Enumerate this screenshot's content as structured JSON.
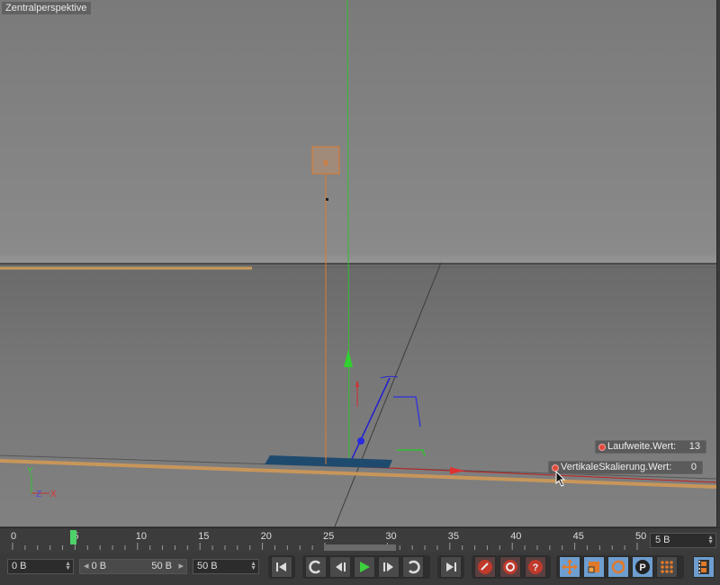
{
  "viewport": {
    "title": "Zentralperspektive"
  },
  "scene": {
    "object_marker_label": "s",
    "axis_labels": {
      "y": "Y",
      "z": "Z",
      "x": "X"
    }
  },
  "hud": [
    {
      "label": "Laufweite.Wert:",
      "value": "13"
    },
    {
      "label": "VertikaleSkalierung.Wert:",
      "value": "0"
    }
  ],
  "timeline": {
    "ruler_labels": [
      "0",
      "5",
      "10",
      "15",
      "20",
      "25",
      "30",
      "35",
      "40",
      "45",
      "50"
    ],
    "current_frame": 5,
    "frame_display": "5 B"
  },
  "toolbar": {
    "start_field": "0 B",
    "range_start": "0 B",
    "range_end": "50 B",
    "end_field": "50 B",
    "buttons": [
      "goto-start",
      "prev-key",
      "prev-frame",
      "play",
      "next-frame",
      "next-key",
      "goto-end",
      "record-key",
      "auto-key",
      "keyframe-selection",
      "move",
      "scale",
      "rotate",
      "parameter",
      "point-level-animation",
      "timeline-window"
    ]
  },
  "colors": {
    "accent_orange": "#e07a2a",
    "hud_dot": "#e04a3a",
    "active_tool_blue": "#6e9ed0",
    "record_red": "#c0392b",
    "play_green": "#3cd23c"
  }
}
